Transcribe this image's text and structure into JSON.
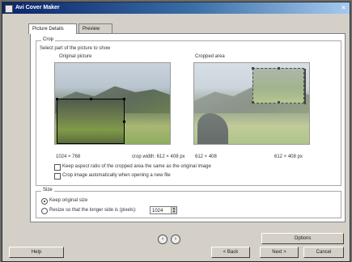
{
  "titlebar": {
    "title": "Avi Cover Maker",
    "close_glyph": "×"
  },
  "tabs": [
    {
      "label": "Picture Details"
    },
    {
      "label": "Preview"
    }
  ],
  "crop_group": {
    "legend": "Crop",
    "instruction": "Select part of the picture to show",
    "original_label": "Original picture",
    "result_label": "Cropped area",
    "original_size": "1024 × 768",
    "original_size_right": "crop width: 612 × 408 px",
    "result_size": "612 × 408",
    "result_size_right": "612 × 408 px",
    "keep_aspect_label": "Keep aspect ratio of the cropped area the same as the original image",
    "crop_on_open_label": "Crop image automatically when opening a new file"
  },
  "resize_group": {
    "legend": "Size",
    "original_label": "Keep original size",
    "custom_label": "Resize so that the longer side is (pixels):",
    "custom_value": "1024"
  },
  "nav": {
    "prev_glyph": "‹",
    "next_glyph": "›"
  },
  "buttons": {
    "options": "Options",
    "help": "Help",
    "back": "< Back",
    "next": "Next >",
    "cancel": "Cancel"
  },
  "icons": {
    "app": "app-icon",
    "close": "close-icon",
    "prev": "previous-icon",
    "next": "next-icon"
  }
}
